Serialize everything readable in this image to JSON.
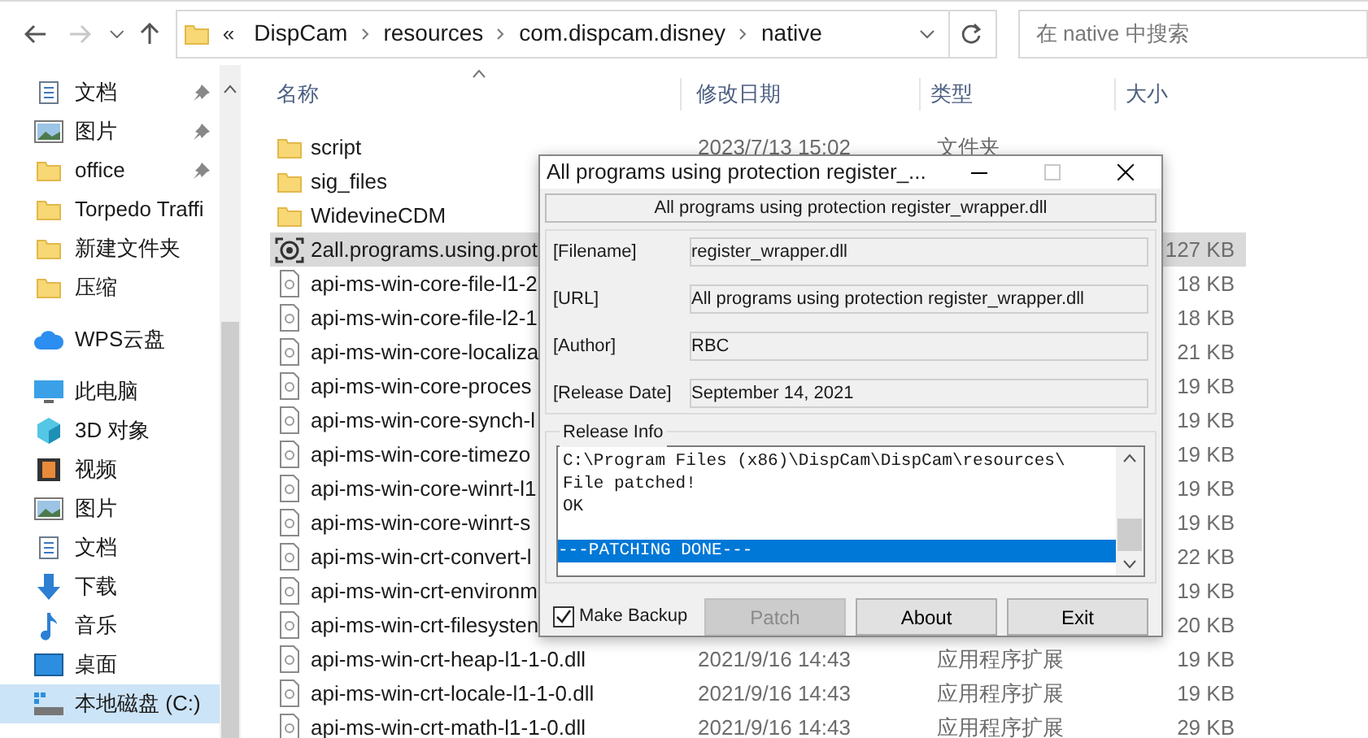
{
  "toolbar": {
    "back_disabled": false,
    "forward_disabled": true,
    "overflow": "«",
    "breadcrumbs": [
      "DispCam",
      "resources",
      "com.dispcam.disney",
      "native"
    ],
    "search": {
      "placeholder": "在 native 中搜索"
    }
  },
  "sidebar": {
    "items": [
      {
        "label": "文档",
        "kind": "doc",
        "pinned": true,
        "selected": false
      },
      {
        "label": "图片",
        "kind": "picture",
        "pinned": true,
        "selected": false
      },
      {
        "label": "office",
        "kind": "folder",
        "pinned": true,
        "selected": false
      },
      {
        "label": "Torpedo Traffi",
        "kind": "folder",
        "pinned": false,
        "selected": false
      },
      {
        "label": "新建文件夹",
        "kind": "folder",
        "pinned": false,
        "selected": false
      },
      {
        "label": "压缩",
        "kind": "folder",
        "pinned": false,
        "selected": false
      },
      {
        "label": "WPS云盘",
        "kind": "cloud",
        "pinned": false,
        "selected": false
      },
      {
        "label": "此电脑",
        "kind": "pc",
        "pinned": false,
        "selected": false
      },
      {
        "label": "3D 对象",
        "kind": "cube",
        "pinned": false,
        "selected": false
      },
      {
        "label": "视频",
        "kind": "video",
        "pinned": false,
        "selected": false
      },
      {
        "label": "图片",
        "kind": "picture",
        "pinned": false,
        "selected": false
      },
      {
        "label": "文档",
        "kind": "doc",
        "pinned": false,
        "selected": false
      },
      {
        "label": "下载",
        "kind": "download",
        "pinned": false,
        "selected": false
      },
      {
        "label": "音乐",
        "kind": "music",
        "pinned": false,
        "selected": false
      },
      {
        "label": "桌面",
        "kind": "desktop",
        "pinned": false,
        "selected": false
      },
      {
        "label": "本地磁盘 (C:)",
        "kind": "drive",
        "pinned": false,
        "selected": true
      }
    ]
  },
  "columns": [
    "名称",
    "修改日期",
    "类型",
    "大小"
  ],
  "files": [
    {
      "name": "script",
      "kind": "folder",
      "date": "2023/7/13 15:02",
      "type": "文件夹",
      "selected": false
    },
    {
      "name": "sig_files",
      "kind": "folder",
      "selected": false
    },
    {
      "name": "WidevineCDM",
      "kind": "folder",
      "selected": false
    },
    {
      "name": "2all.programs.using.prot",
      "kind": "exe",
      "size": "127 KB",
      "selected": true
    },
    {
      "name": "api-ms-win-core-file-l1-2",
      "kind": "dll",
      "size": "18 KB",
      "selected": false
    },
    {
      "name": "api-ms-win-core-file-l2-1",
      "kind": "dll",
      "size": "18 KB",
      "selected": false
    },
    {
      "name": "api-ms-win-core-localiza",
      "kind": "dll",
      "size": "21 KB",
      "selected": false
    },
    {
      "name": "api-ms-win-core-proces",
      "kind": "dll",
      "size": "19 KB",
      "selected": false
    },
    {
      "name": "api-ms-win-core-synch-l",
      "kind": "dll",
      "size": "19 KB",
      "selected": false
    },
    {
      "name": "api-ms-win-core-timezo",
      "kind": "dll",
      "size": "19 KB",
      "selected": false
    },
    {
      "name": "api-ms-win-core-winrt-l1",
      "kind": "dll",
      "size": "19 KB",
      "selected": false
    },
    {
      "name": "api-ms-win-core-winrt-s",
      "kind": "dll",
      "size": "19 KB",
      "selected": false
    },
    {
      "name": "api-ms-win-crt-convert-l",
      "kind": "dll",
      "size": "22 KB",
      "selected": false
    },
    {
      "name": "api-ms-win-crt-environm",
      "kind": "dll",
      "size": "19 KB",
      "selected": false
    },
    {
      "name": "api-ms-win-crt-filesysten",
      "kind": "dll",
      "size": "20 KB",
      "selected": false
    },
    {
      "name": "api-ms-win-crt-heap-l1-1-0.dll",
      "kind": "dll",
      "date": "2021/9/16 14:43",
      "type": "应用程序扩展",
      "size": "19 KB",
      "selected": false
    },
    {
      "name": "api-ms-win-crt-locale-l1-1-0.dll",
      "kind": "dll",
      "date": "2021/9/16 14:43",
      "type": "应用程序扩展",
      "size": "19 KB",
      "selected": false
    },
    {
      "name": "api-ms-win-crt-math-l1-1-0.dll",
      "kind": "dll",
      "date": "2021/9/16 14:43",
      "type": "应用程序扩展",
      "size": "29 KB",
      "selected": false
    }
  ],
  "dialog": {
    "title": "All programs using protection register_...",
    "maximize_disabled": true,
    "header": "All programs using protection register_wrapper.dll",
    "fields": [
      {
        "label": "[Filename]",
        "value": "register_wrapper.dll"
      },
      {
        "label": "[URL]",
        "value": "All programs using protection register_wrapper.dll"
      },
      {
        "label": "[Author]",
        "value": "RBC"
      },
      {
        "label": "[Release Date]",
        "value": "September 14, 2021"
      }
    ],
    "release_info": {
      "legend": "Release Info",
      "lines": [
        {
          "text": "C:\\Program Files (x86)\\DispCam\\DispCam\\resources\\",
          "selected": false
        },
        {
          "text": "File patched!",
          "selected": false
        },
        {
          "text": "OK",
          "selected": false
        },
        {
          "text": "---PATCHING DONE---",
          "selected": true
        }
      ]
    },
    "make_backup": {
      "label": "Make Backup",
      "checked": true
    },
    "buttons": [
      {
        "label": "Patch",
        "disabled": true
      },
      {
        "label": "About",
        "disabled": false
      },
      {
        "label": "Exit",
        "disabled": false
      }
    ]
  }
}
